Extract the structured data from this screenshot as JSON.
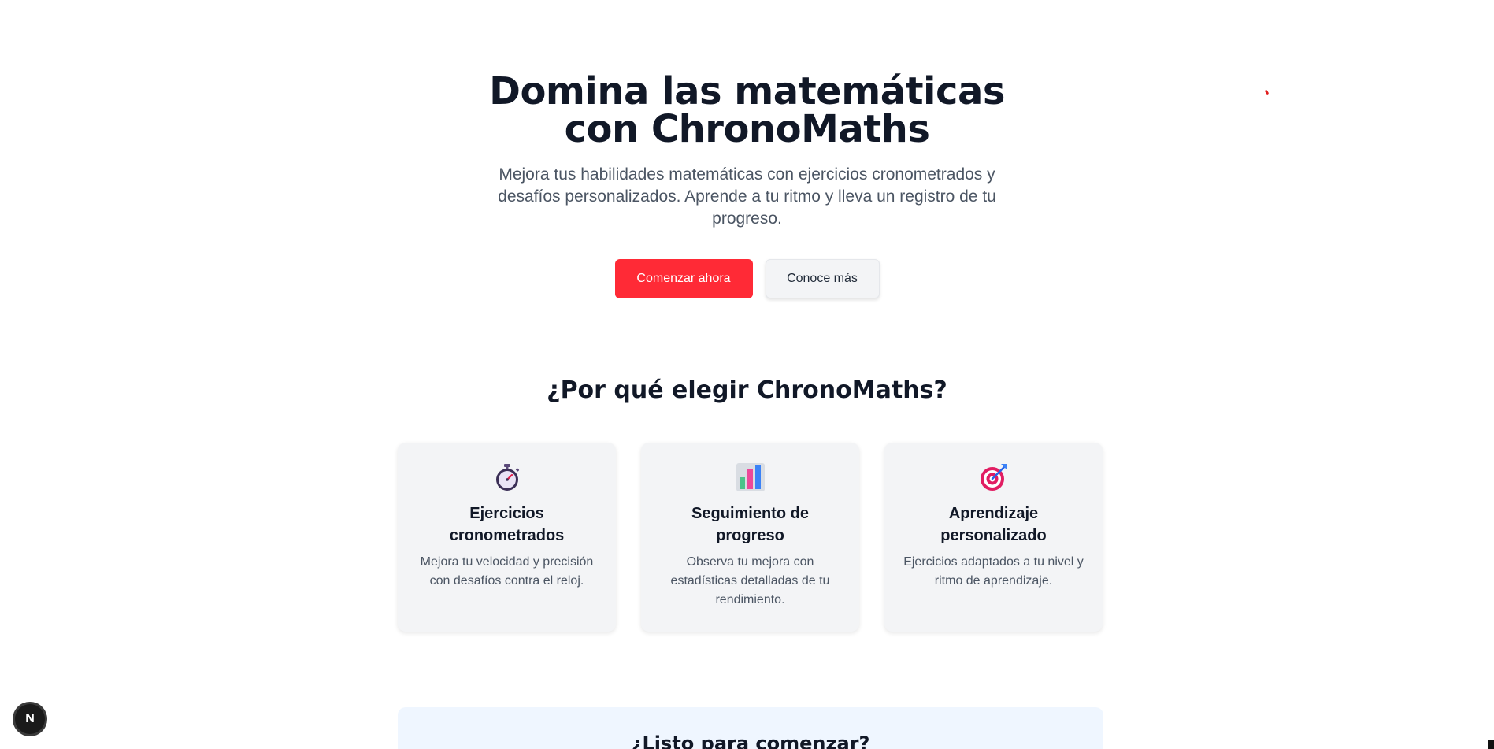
{
  "hero": {
    "title": "Domina las matemáticas con ChronoMaths",
    "subtitle": "Mejora tus habilidades matemáticas con ejercicios cronometrados y desafíos personalizados. Aprende a tu ritmo y lleva un registro de tu progreso.",
    "primary_cta": "Comenzar ahora",
    "secondary_cta": "Conoce más"
  },
  "features": {
    "title": "¿Por qué elegir ChronoMaths?",
    "cards": [
      {
        "icon": "stopwatch-icon",
        "title": "Ejercicios cronometrados",
        "description": "Mejora tu velocidad y precisión con desafíos contra el reloj."
      },
      {
        "icon": "bar-chart-icon",
        "title": "Seguimiento de progreso",
        "description": "Observa tu mejora con estadísticas detalladas de tu rendimiento."
      },
      {
        "icon": "target-icon",
        "title": "Aprendizaje personalizado",
        "description": "Ejercicios adaptados a tu nivel y ritmo de aprendizaje."
      }
    ]
  },
  "ready": {
    "title": "¿Listo para comenzar?"
  },
  "dev_badge": {
    "label": "N"
  },
  "colors": {
    "primary": "#ff2a36",
    "heading": "#111827",
    "muted": "#4b5563",
    "card_bg": "#f3f4f6",
    "ready_bg": "#eff6ff"
  }
}
